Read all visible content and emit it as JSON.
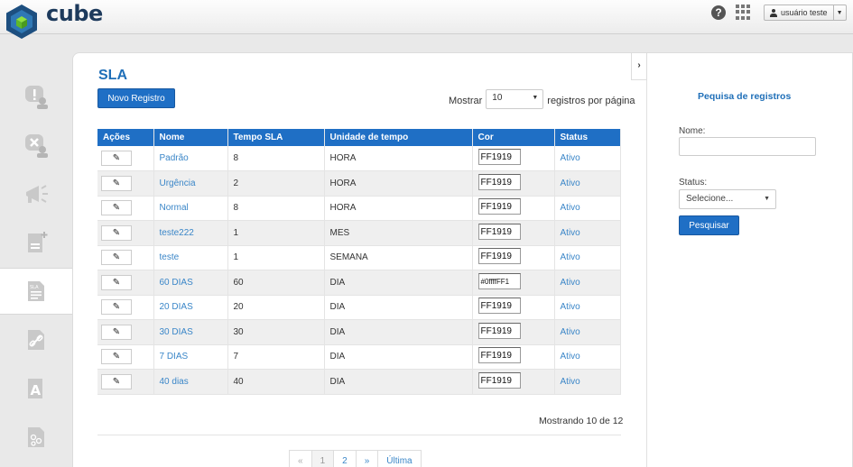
{
  "app": {
    "name": "cube"
  },
  "header": {
    "user_label": "usuário teste"
  },
  "page": {
    "title": "SLA",
    "new_button": "Novo Registro"
  },
  "per_page": {
    "prefix": "Mostrar",
    "value": "10",
    "suffix": "registros por página"
  },
  "table": {
    "columns": [
      "Ações",
      "Nome",
      "Tempo SLA",
      "Unidade de tempo",
      "Cor",
      "Status"
    ],
    "rows": [
      {
        "nome": "Padrão",
        "tempo": "8",
        "unidade": "HORA",
        "cor": "FF1919",
        "status": "Ativo"
      },
      {
        "nome": "Urgência",
        "tempo": "2",
        "unidade": "HORA",
        "cor": "FF1919",
        "status": "Ativo"
      },
      {
        "nome": "Normal",
        "tempo": "8",
        "unidade": "HORA",
        "cor": "FF1919",
        "status": "Ativo"
      },
      {
        "nome": "teste222",
        "tempo": "1",
        "unidade": "MES",
        "cor": "FF1919",
        "status": "Ativo"
      },
      {
        "nome": "teste",
        "tempo": "1",
        "unidade": "SEMANA",
        "cor": "FF1919",
        "status": "Ativo"
      },
      {
        "nome": "60 DIAS",
        "tempo": "60",
        "unidade": "DIA",
        "cor": "#0ffffFF1",
        "status": "Ativo"
      },
      {
        "nome": "20 DIAS",
        "tempo": "20",
        "unidade": "DIA",
        "cor": "FF1919",
        "status": "Ativo"
      },
      {
        "nome": "30 DIAS",
        "tempo": "30",
        "unidade": "DIA",
        "cor": "FF1919",
        "status": "Ativo"
      },
      {
        "nome": "7 DIAS",
        "tempo": "7",
        "unidade": "DIA",
        "cor": "FF1919",
        "status": "Ativo"
      },
      {
        "nome": "40 dias",
        "tempo": "40",
        "unidade": "DIA",
        "cor": "FF1919",
        "status": "Ativo"
      }
    ]
  },
  "footer": {
    "showing": "Mostrando 10 de 12"
  },
  "pagination": {
    "first": "«",
    "pages": [
      "1",
      "2"
    ],
    "next": "»",
    "last": "Última"
  },
  "search": {
    "title": "Pequisa de registros",
    "name_label": "Nome:",
    "name_value": "",
    "status_label": "Status:",
    "status_value": "Selecione...",
    "button": "Pesquisar"
  },
  "colors": {
    "accent": "#1f6fc5",
    "link": "#3a86c8",
    "title": "#1f6fb8"
  },
  "icons": {
    "header": [
      "help-icon",
      "apps-grid-icon",
      "user-icon",
      "chevron-down-icon"
    ],
    "sidebar": [
      "alert-user-icon",
      "user-cancel-icon",
      "megaphone-icon",
      "add-document-icon",
      "sla-document-icon",
      "link-document-icon",
      "font-document-icon",
      "org-document-icon"
    ],
    "table": "pencil-icon",
    "panel": "chevron-right-icon"
  }
}
